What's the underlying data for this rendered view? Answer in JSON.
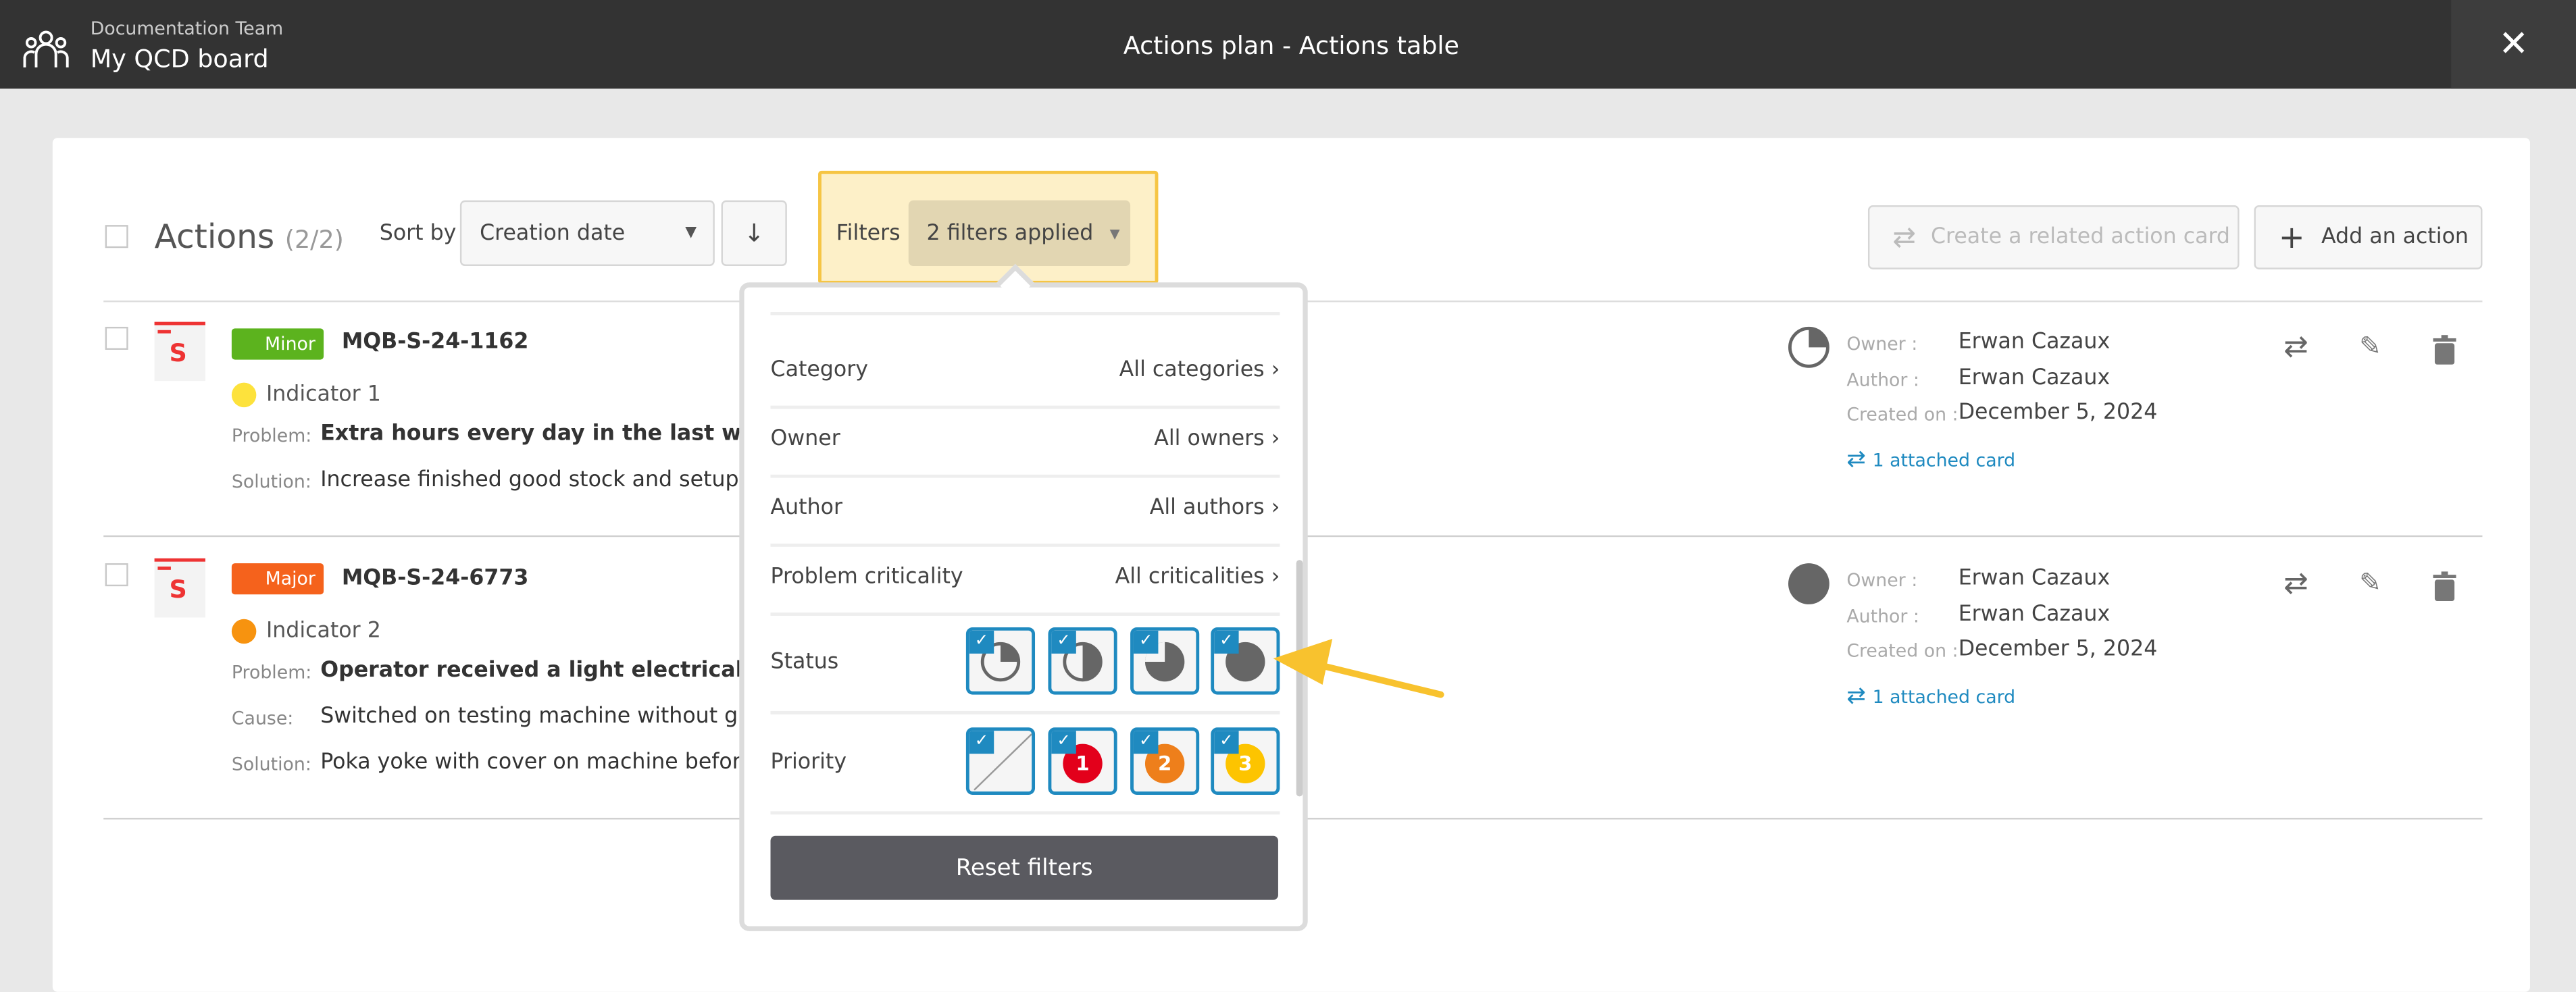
{
  "header": {
    "team": "Documentation Team",
    "board": "My QCD board",
    "title": "Actions plan - Actions table",
    "close_icon": "close-icon"
  },
  "toolbar": {
    "title": "Actions",
    "count": "(2/2)",
    "sort_label": "Sort by",
    "sort_value": "Creation date",
    "filters_label": "Filters",
    "filters_value": "2 filters applied",
    "create_related": "Create a related action card",
    "add_action": "Add an action"
  },
  "actions": [
    {
      "criticality": "Minor",
      "criticality_color": "#5cb31e",
      "id": "MQB-S-24-1162",
      "indicator": "Indicator 1",
      "indicator_color": "#fde23c",
      "problem_label": "Problem:",
      "problem": "Extra hours every day in the last week to t",
      "solution_label": "Solution:",
      "solution": "Increase finished good stock and setup ex",
      "status": "quarter",
      "owner_label": "Owner :",
      "owner": "Erwan Cazaux",
      "author_label": "Author :",
      "author": "Erwan Cazaux",
      "created_label": "Created on :",
      "created": "December 5, 2024",
      "attached": "1 attached card"
    },
    {
      "criticality": "Major",
      "criticality_color": "#f5621c",
      "id": "MQB-S-24-6773",
      "indicator": "Indicator 2",
      "indicator_color": "#f7930f",
      "problem_label": "Problem:",
      "problem": "Operator received a light electrical shock c",
      "cause_label": "Cause:",
      "cause": "Switched on testing machine without glov",
      "solution_label": "Solution:",
      "solution": "Poka yoke with cover on machine before t",
      "status": "full",
      "owner_label": "Owner :",
      "owner": "Erwan Cazaux",
      "author_label": "Author :",
      "author": "Erwan Cazaux",
      "created_label": "Created on :",
      "created": "December 5, 2024",
      "attached": "1 attached card"
    }
  ],
  "filters": {
    "rows": [
      {
        "label": "Category",
        "value": "All categories"
      },
      {
        "label": "Owner",
        "value": "All owners"
      },
      {
        "label": "Author",
        "value": "All authors"
      },
      {
        "label": "Problem criticality",
        "value": "All criticalities"
      }
    ],
    "status_label": "Status",
    "status_options": [
      "quarter",
      "half",
      "three-quarter",
      "complete"
    ],
    "priority_label": "Priority",
    "priority_options": [
      {
        "label": ""
      },
      {
        "label": "1",
        "color": "#e3001b"
      },
      {
        "label": "2",
        "color": "#ee7f1b"
      },
      {
        "label": "3",
        "color": "#fdc400"
      }
    ],
    "reset": "Reset filters"
  },
  "colors": {
    "accent": "#1f8ac0",
    "highlight": "#f6c544"
  }
}
